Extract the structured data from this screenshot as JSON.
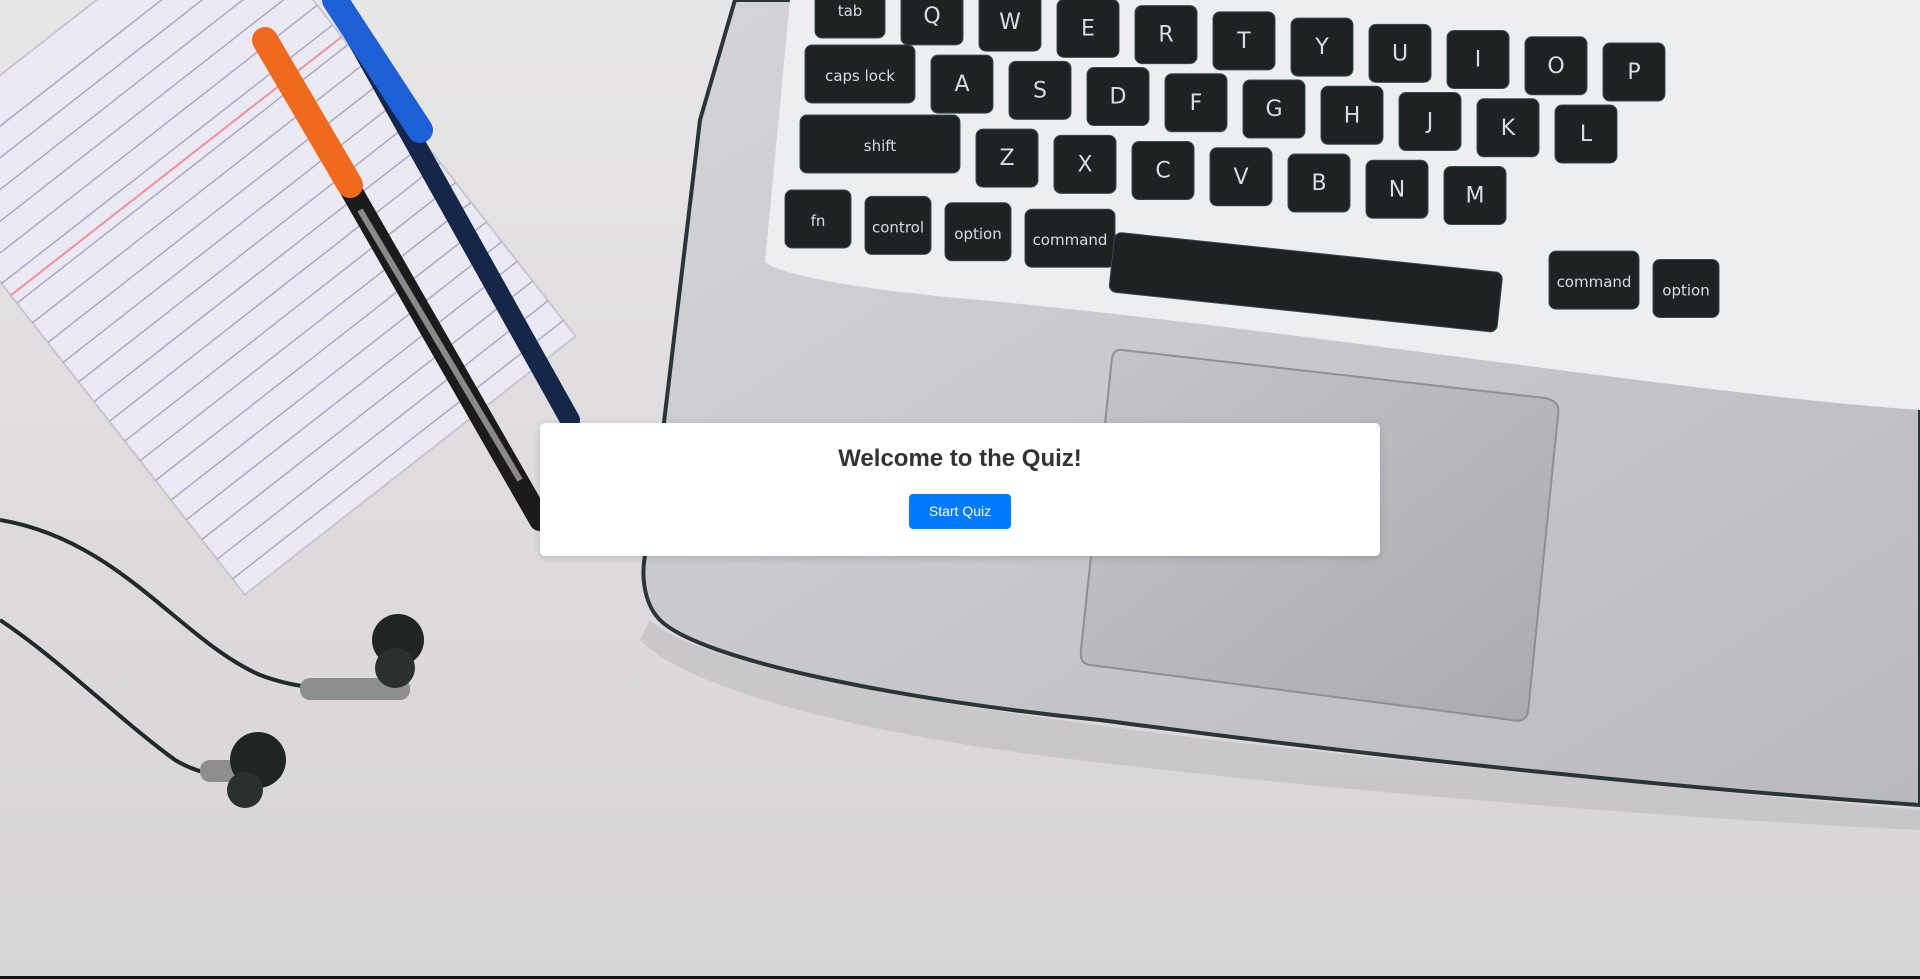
{
  "quiz": {
    "title": "Welcome to the Quiz!",
    "start_label": "Start Quiz",
    "accent_color": "#007bff"
  },
  "background": {
    "description_icon": "desk-photo",
    "keyboard": {
      "row1": [
        "tab",
        "Q",
        "W",
        "E",
        "R",
        "T",
        "Y",
        "U",
        "I",
        "O",
        "P"
      ],
      "row2": [
        "caps lock",
        "A",
        "S",
        "D",
        "F",
        "G",
        "H",
        "J",
        "K",
        "L"
      ],
      "row3": [
        "shift",
        "Z",
        "X",
        "C",
        "V",
        "B",
        "N",
        "M"
      ],
      "row4": [
        "fn",
        "control",
        "option",
        "command",
        "command",
        "option"
      ]
    }
  }
}
